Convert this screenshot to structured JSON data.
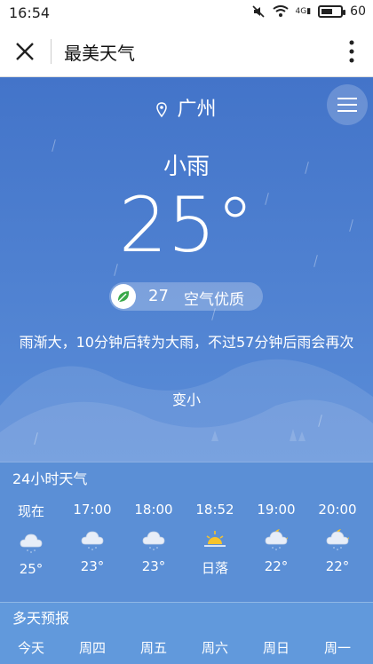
{
  "status": {
    "time": "16:54",
    "battery": "60",
    "battery_level": 0.6,
    "network": "4G"
  },
  "nav": {
    "title": "最美天气"
  },
  "weather": {
    "city": "广州",
    "condition": "小雨",
    "temperature": "25°",
    "aqi_value": "27",
    "aqi_label": "空气优质",
    "desc_line1": "雨渐大，10分钟后转为大雨，不过57分钟后雨会再次",
    "desc_line2": "变小"
  },
  "hourly": {
    "title": "24小时天气",
    "items": [
      {
        "time": "现在",
        "icon": "cloud-rain-icon",
        "value": "25°"
      },
      {
        "time": "17:00",
        "icon": "cloud-rain-icon",
        "value": "23°"
      },
      {
        "time": "18:00",
        "icon": "cloud-rain-icon",
        "value": "23°"
      },
      {
        "time": "18:52",
        "icon": "sunset-icon",
        "value": "日落"
      },
      {
        "time": "19:00",
        "icon": "moon-cloud-rain-icon",
        "value": "22°"
      },
      {
        "time": "20:00",
        "icon": "moon-cloud-rain-icon",
        "value": "22°"
      }
    ]
  },
  "daily": {
    "title": "多天预报",
    "days": [
      "今天",
      "周四",
      "周五",
      "周六",
      "周日",
      "周一"
    ]
  }
}
